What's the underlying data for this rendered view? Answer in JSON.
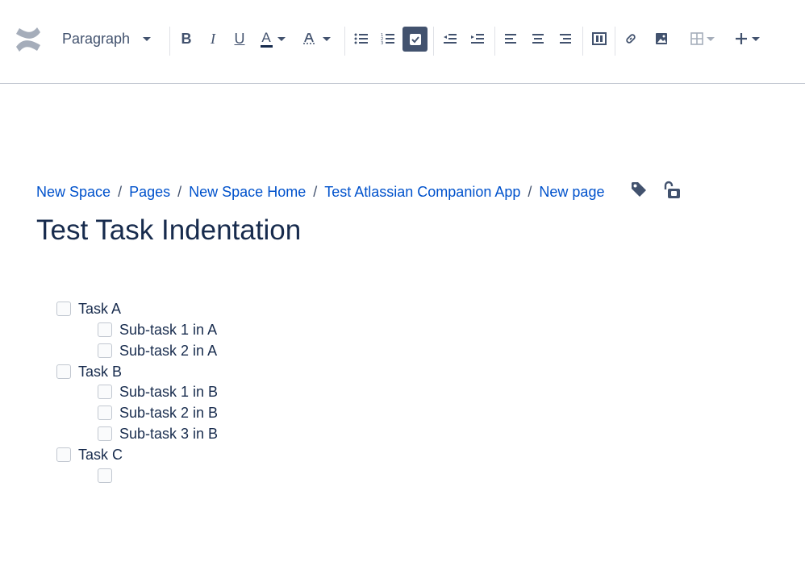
{
  "toolbar": {
    "logo_icon": "confluence-logo-icon",
    "paragraph_label": "Paragraph",
    "bold_label": "B",
    "italic_label": "I",
    "underline_label": "U",
    "text_color_label": "A",
    "text_color_accent": "#172b4d",
    "active_button_color": "#42526e"
  },
  "breadcrumb": [
    {
      "label": "New Space"
    },
    {
      "label": "Pages"
    },
    {
      "label": "New Space Home"
    },
    {
      "label": "Test Atlassian Companion App"
    },
    {
      "label": "New page"
    }
  ],
  "page": {
    "title": "Test Task Indentation"
  },
  "tasks": [
    {
      "label": "Task A",
      "checked": false,
      "level": 0
    },
    {
      "label": "Sub-task 1 in A",
      "checked": false,
      "level": 1
    },
    {
      "label": "Sub-task 2 in A",
      "checked": false,
      "level": 1
    },
    {
      "label": "Task B",
      "checked": false,
      "level": 0
    },
    {
      "label": "Sub-task 1 in B",
      "checked": false,
      "level": 1
    },
    {
      "label": "Sub-task 2 in B",
      "checked": false,
      "level": 1
    },
    {
      "label": "Sub-task 3 in B",
      "checked": false,
      "level": 1
    },
    {
      "label": "Task C",
      "checked": false,
      "level": 0
    },
    {
      "label": "",
      "checked": false,
      "level": 1
    }
  ],
  "colors": {
    "link": "#0052cc",
    "text": "#172b4d",
    "icon": "#42526e"
  }
}
